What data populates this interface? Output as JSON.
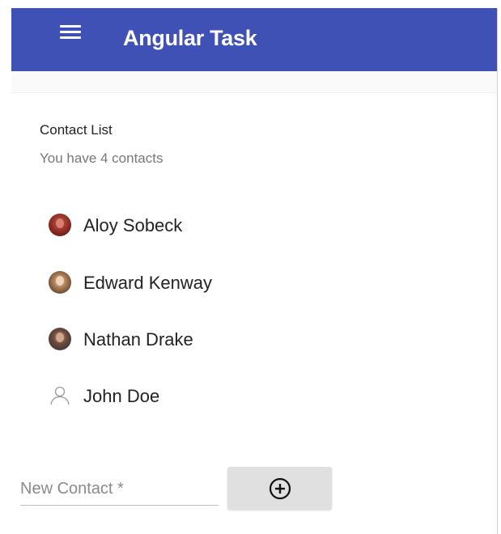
{
  "toolbar": {
    "title": "Angular Task",
    "menu_icon": "menu-icon",
    "color": "#3f51b5"
  },
  "contacts": {
    "title": "Contact List",
    "subtitle": "You have 4 contacts",
    "items": [
      {
        "name": "Aloy Sobeck",
        "avatar": "photo"
      },
      {
        "name": "Edward Kenway",
        "avatar": "photo"
      },
      {
        "name": "Nathan Drake",
        "avatar": "photo"
      },
      {
        "name": "John Doe",
        "avatar": "person-outline-icon"
      }
    ]
  },
  "new_contact": {
    "placeholder": "New Contact *",
    "value": "",
    "add_icon": "add-circle-icon"
  }
}
